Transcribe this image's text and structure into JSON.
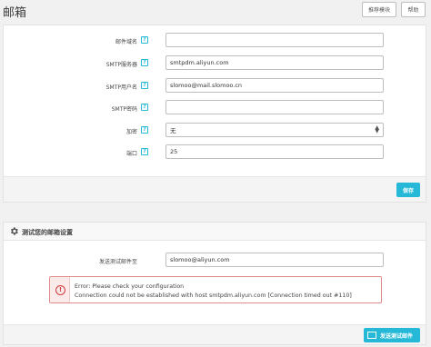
{
  "header": {
    "title": "邮箱",
    "recommended_modules": "推荐模块",
    "help": "帮助"
  },
  "mail_settings": {
    "fields": [
      {
        "label": "邮件域名",
        "value": ""
      },
      {
        "label": "SMTP服务器",
        "value": "smtpdm.aliyun.com"
      },
      {
        "label": "SMTP用户名",
        "value": "slomoo@mail.slomoo.cn"
      },
      {
        "label": "SMTP密码",
        "value": ""
      }
    ],
    "encryption": {
      "label": "加密",
      "value": "无"
    },
    "port": {
      "label": "端口",
      "value": "25"
    },
    "help_glyph": "?",
    "save_label": "保存"
  },
  "test_panel": {
    "title": "测试您的邮箱设置",
    "send_to_label": "发送测试邮件至",
    "send_to_value": "slomoo@aliyun.com",
    "alert": {
      "glyph": "!",
      "line1": "Error: Please check your configuration",
      "line2": "Connection could not be established with host smtpdm.aliyun.com [Connection timed out #110]"
    },
    "send_button_label": "发送测试邮件"
  },
  "colors": {
    "accent": "#25b9d7",
    "error": "#d63b3b"
  }
}
